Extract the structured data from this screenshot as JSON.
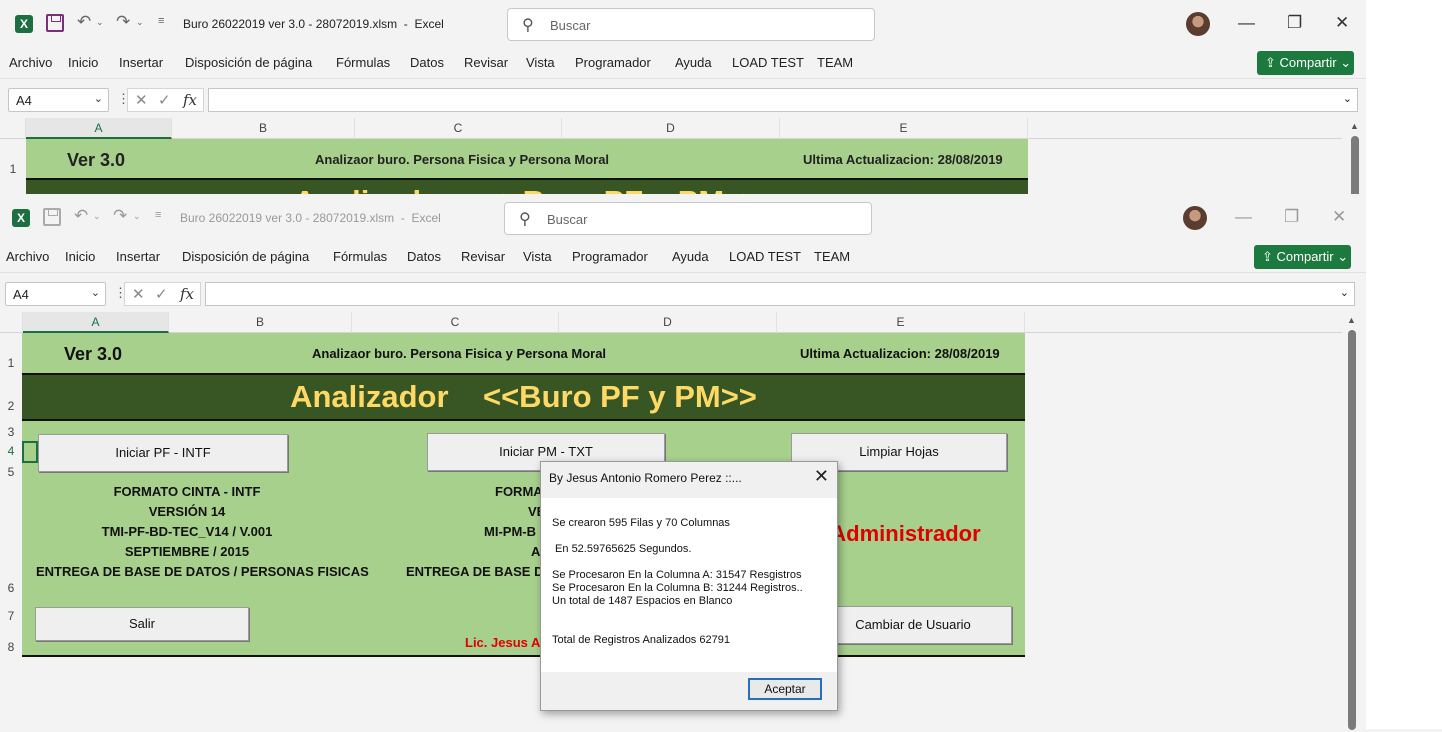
{
  "window": {
    "title": "Buro 26022019 ver 3.0 - 28072019.xlsm  -  Excel",
    "search_placeholder": "Buscar",
    "share_label": "Compartir"
  },
  "ribbon_tabs": [
    "Archivo",
    "Inicio",
    "Insertar",
    "Disposición de página",
    "Fórmulas",
    "Datos",
    "Revisar",
    "Vista",
    "Programador",
    "Ayuda",
    "LOAD TEST",
    "TEAM"
  ],
  "formula_bar": {
    "name_box": "A4",
    "formula": ""
  },
  "columns": [
    "A",
    "B",
    "C",
    "D",
    "E"
  ],
  "rows": [
    "1",
    "2",
    "3",
    "4",
    "5",
    "6",
    "7",
    "8"
  ],
  "sheet": {
    "version": "Ver 3.0",
    "subtitle": "Analizaor buro. Persona Fisica y Persona Moral",
    "updated": "Ultima Actualizacion: 28/08/2019",
    "main_title": "Analizador    <<Buro PF y PM>>",
    "btn_pf": "Iniciar PF - INTF",
    "btn_pm": "Iniciar PM - TXT",
    "btn_clear": "Limpiar Hojas",
    "btn_exit": "Salir",
    "btn_user": "Cambiar de Usuario",
    "pf_info": [
      "FORMATO CINTA - INTF",
      "VERSIÓN 14",
      "TMI-PF-BD-TEC_V14 / V.001",
      "SEPTIEMBRE / 2015",
      "ENTREGA DE BASE DE DATOS / PERSONAS FISICAS"
    ],
    "pm_info": [
      "FORMA",
      "VE",
      "MI-PM-B",
      "A",
      "ENTREGA DE BASE DE"
    ],
    "user_status": "vo: Administrador",
    "author": "Lic. Jesus An"
  },
  "dialog": {
    "title": "By Jesus Antonio Romero Perez ::...",
    "lines": [
      "Se crearon 595 Filas y 70 Columnas",
      " En 52.59765625 Segundos.",
      "Se Procesaron En la Columna A: 31547 Resgistros",
      "Se Procesaron En la Columna B: 31244 Registros..",
      "Un total de 1487 Espacios en Blanco",
      "Total de Registros Analizados 62791"
    ],
    "ok": "Aceptar"
  },
  "colors": {
    "sheet_green": "#a8d08d",
    "title_dark": "#375623",
    "title_text": "#ffd966",
    "accent_red": "#e00000",
    "excel_green": "#1d6f42"
  }
}
